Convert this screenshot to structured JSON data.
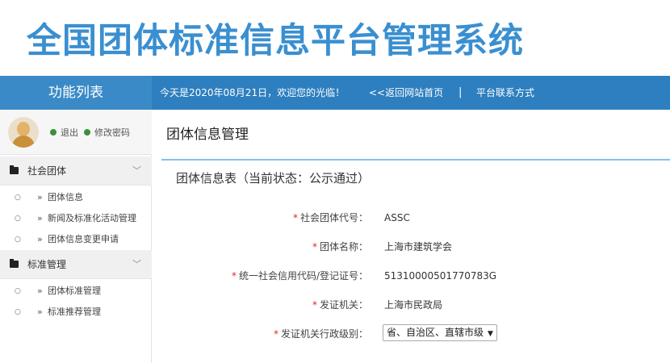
{
  "header": {
    "site_title": "全国团体标准信息平台管理系统"
  },
  "topbar": {
    "func_list": "功能列表",
    "welcome": "今天是2020年08月21日，欢迎您的光临！",
    "home_link": "<<返回网站首页",
    "separator": "|",
    "contact_link": "平台联系方式"
  },
  "user": {
    "logout": "退出",
    "change_password": "修改密码"
  },
  "sidebar": {
    "groups": [
      {
        "label": "社会团体",
        "items": [
          {
            "label": "团体信息"
          },
          {
            "label": "新闻及标准化活动管理"
          },
          {
            "label": "团体信息变更申请"
          }
        ]
      },
      {
        "label": "标准管理",
        "items": [
          {
            "label": "团体标准管理"
          },
          {
            "label": "标准推荐管理"
          }
        ]
      }
    ]
  },
  "main": {
    "page_title": "团体信息管理",
    "table_title": "团体信息表（当前状态：公示通过）",
    "fields": [
      {
        "label": "社会团体代号：",
        "value": "ASSC"
      },
      {
        "label": "团体名称：",
        "value": "上海市建筑学会"
      },
      {
        "label": "统一社会信用代码/登记证号：",
        "value": "51310000501770783G"
      },
      {
        "label": "发证机关：",
        "value": "上海市民政局"
      },
      {
        "label": "发证机关行政级别：",
        "value": "省、自治区、直辖市级"
      }
    ]
  },
  "colors": {
    "brand_blue": "#2d7fbf",
    "title_blue": "#3a8fd0",
    "required_red": "#e0262a"
  }
}
